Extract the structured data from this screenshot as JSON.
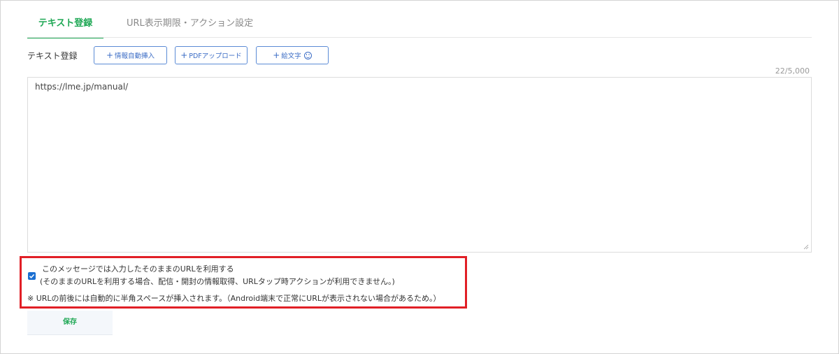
{
  "tabs": {
    "text_registration": "テキスト登録",
    "url_settings": "URL表示期限・アクション設定"
  },
  "editor": {
    "field_label": "テキスト登録",
    "insert_info_label": "情報自動挿入",
    "pdf_upload_label": "PDFアップロード",
    "emoji_label": "絵文字",
    "char_count": "22/5,000",
    "text_value": "https://lme.jp/manual/"
  },
  "option": {
    "use_url_as_is": "このメッセージでは入力したそのままのURLを利用する",
    "use_url_as_is_note": "(そのままのURLを利用する場合、配信・開封の情報取得、URLタップ時アクションが利用できません。)",
    "checked": true,
    "space_note": "※ URLの前後には自動的に半角スペースが挿入されます。（Android端末で正常にURLが表示されない場合があるため。）"
  },
  "actions": {
    "save_label": "保存"
  },
  "colors": {
    "accent_green": "#1fa855",
    "button_blue": "#3b6cc5",
    "highlight_red": "#e11f26",
    "checkbox_blue": "#1b6fd1"
  }
}
